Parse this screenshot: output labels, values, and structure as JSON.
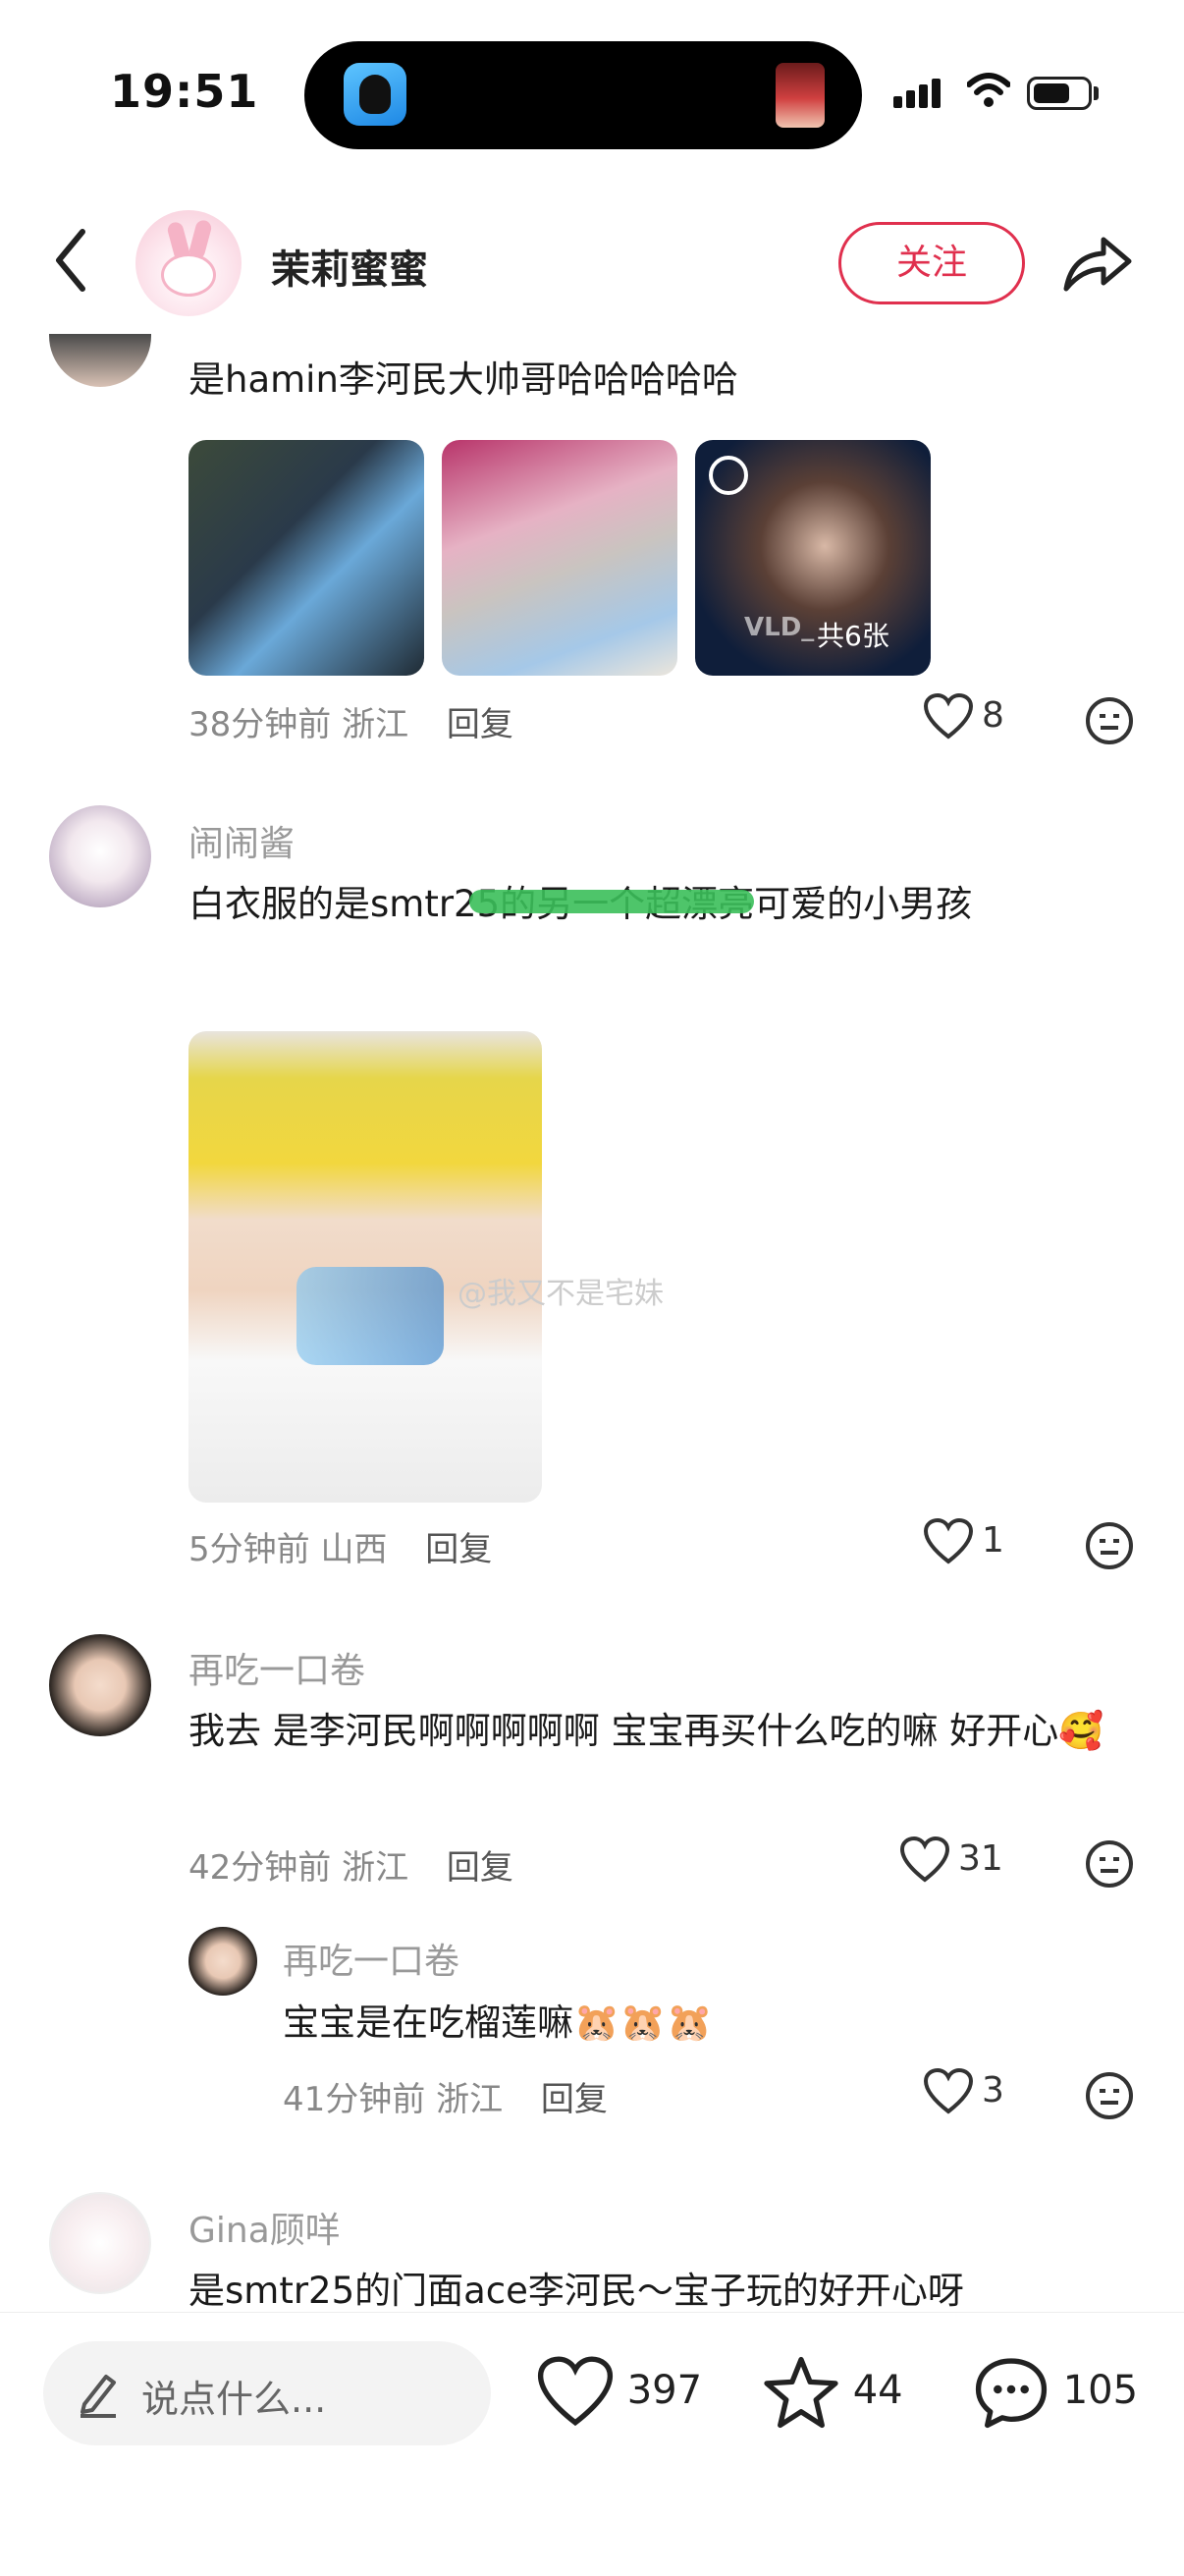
{
  "status_bar": {
    "time": "19:51"
  },
  "header": {
    "username": "茉莉蜜蜜",
    "follow_label": "关注"
  },
  "comments": [
    {
      "text": "是hamin李河民大帅哥哈哈哈哈哈",
      "image_overlay": "共6张",
      "image_watermark": "VLD_",
      "time": "38分钟前",
      "location": "浙江",
      "reply": "回复",
      "likes": "8"
    },
    {
      "user": "闹闹酱",
      "text": "白衣服的是smtr25的另一个超漂亮可爱的小男孩",
      "image_watermark": "@我又不是宅妹",
      "time": "5分钟前",
      "location": "山西",
      "reply": "回复",
      "likes": "1"
    },
    {
      "user": "再吃一口卷",
      "text": "我去 是李河民啊啊啊啊啊  宝宝再买什么吃的嘛 好开心🥰",
      "time": "42分钟前",
      "location": "浙江",
      "reply": "回复",
      "likes": "31",
      "sub_reply": {
        "user": "再吃一口卷",
        "text": "宝宝是在吃榴莲嘛",
        "time": "41分钟前",
        "location": "浙江",
        "reply": "回复",
        "likes": "3"
      }
    },
    {
      "user": "Gina顾咩",
      "text": "是smtr25的门面ace李河民～宝子玩的好开心呀"
    }
  ],
  "bottom_bar": {
    "input_placeholder": "说点什么...",
    "likes": "397",
    "stars": "44",
    "comments": "105"
  },
  "icons": [
    "back-icon",
    "share-icon",
    "heart-icon",
    "dislike-icon",
    "pencil-icon",
    "star-icon",
    "comment-icon",
    "wifi-icon",
    "battery-icon",
    "signal-icon"
  ],
  "colors": {
    "accent": "#e0304e",
    "muted": "#888888"
  }
}
